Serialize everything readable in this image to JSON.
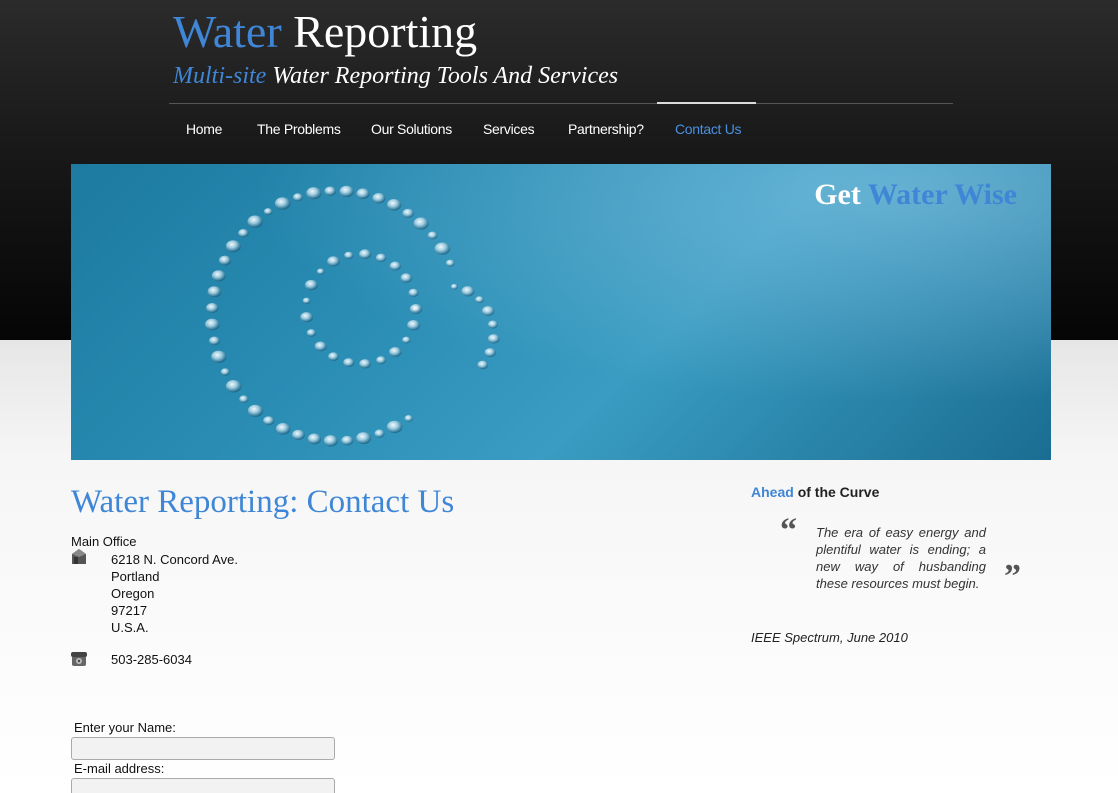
{
  "header": {
    "title_part1": "Water",
    "title_part2": "Reporting",
    "tagline_part1": "Multi-site",
    "tagline_part2": "Water Reporting Tools And Services"
  },
  "nav": {
    "items": [
      {
        "label": "Home"
      },
      {
        "label": "The Problems"
      },
      {
        "label": "Our Solutions"
      },
      {
        "label": "Services"
      },
      {
        "label": "Partnership?"
      },
      {
        "label": "Contact Us",
        "active": true
      }
    ]
  },
  "banner": {
    "text_part1": "Get",
    "text_part2": "Water Wise"
  },
  "main": {
    "title": "Water Reporting: Contact Us",
    "office_label": "Main Office",
    "address": [
      "6218 N. Concord Ave.",
      "Portland",
      "Oregon",
      "97217",
      "U.S.A."
    ],
    "phone": "503-285-6034",
    "form": {
      "name_label": "Enter your Name:",
      "email_label": "E-mail address:"
    }
  },
  "sidebar": {
    "heading_part1": "Ahead",
    "heading_part2": "of the Curve",
    "quote_open": "“",
    "quote_close": "”",
    "quote": "The era of easy energy and plentiful water is ending; a new way of husbanding these resources must begin.",
    "source": "IEEE Spectrum, June 2010"
  },
  "colors": {
    "accent": "#3f86d6",
    "header_bg": "#1a1a1a",
    "banner": "#2a8db4"
  },
  "icons": {
    "address": "house-icon",
    "phone": "telephone-icon",
    "banner_art": "at-sign-water-drops-icon"
  }
}
